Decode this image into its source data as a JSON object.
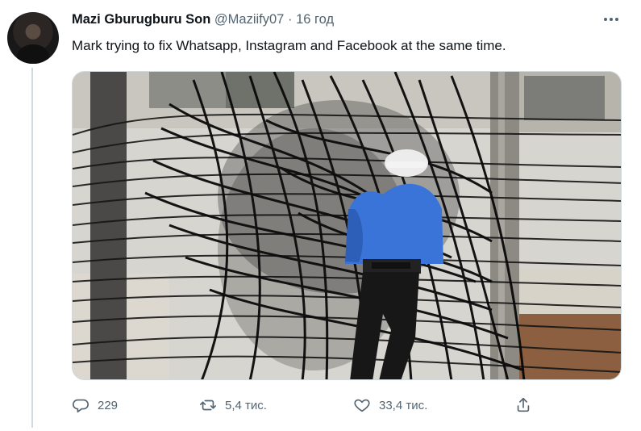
{
  "tweet": {
    "author_name": "Mazi Gburugburu Son",
    "handle": "@Maziify07",
    "separator": "·",
    "time": "16 год",
    "text": "Mark trying to fix Whatsapp, Instagram and Facebook at the same time."
  },
  "actions": {
    "reply_count": "229",
    "retweet_count": "5,4 тис.",
    "like_count": "33,4 тис."
  },
  "icons": [
    "more-icon",
    "reply-icon",
    "retweet-icon",
    "like-icon",
    "share-icon"
  ],
  "colors": {
    "text": "#0f1419",
    "secondary": "#536471",
    "border": "#cfd9de"
  }
}
